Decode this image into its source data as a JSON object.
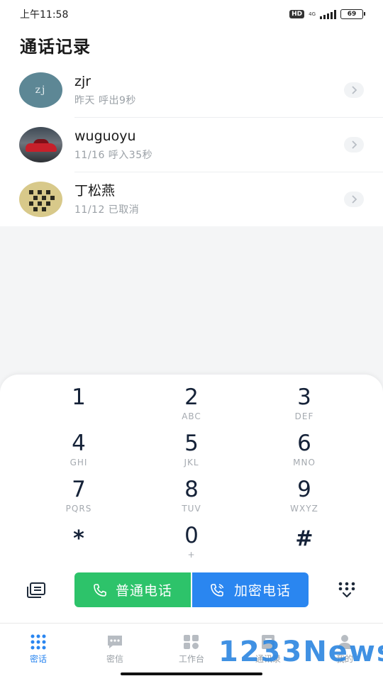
{
  "status_bar": {
    "time": "上午11:58",
    "hd": "HD",
    "network": "4G",
    "battery": "69"
  },
  "header": {
    "title": "通话记录"
  },
  "calls": [
    {
      "name": "zjr",
      "avatar_text": "zj",
      "meta": "昨天 呼出9秒"
    },
    {
      "name": "wuguoyu",
      "meta": "11/16 呼入35秒"
    },
    {
      "name": "丁松燕",
      "meta": "11/12 已取消"
    }
  ],
  "dialpad": {
    "keys": [
      {
        "digit": "1",
        "letters": ""
      },
      {
        "digit": "2",
        "letters": "ABC"
      },
      {
        "digit": "3",
        "letters": "DEF"
      },
      {
        "digit": "4",
        "letters": "GHI"
      },
      {
        "digit": "5",
        "letters": "JKL"
      },
      {
        "digit": "6",
        "letters": "MNO"
      },
      {
        "digit": "7",
        "letters": "PQRS"
      },
      {
        "digit": "8",
        "letters": "TUV"
      },
      {
        "digit": "9",
        "letters": "WXYZ"
      },
      {
        "digit": "*",
        "letters": ""
      },
      {
        "digit": "0",
        "letters": "+"
      },
      {
        "digit": "#",
        "letters": ""
      }
    ],
    "normal_call_label": "普通电话",
    "encrypted_call_label": "加密电话"
  },
  "tabs": [
    {
      "label": "密话",
      "icon": "dialpad-grid-icon",
      "active": true
    },
    {
      "label": "密信",
      "icon": "message-icon",
      "active": false
    },
    {
      "label": "工作台",
      "icon": "workbench-icon",
      "active": false
    },
    {
      "label": "通讯录",
      "icon": "contacts-icon",
      "active": false
    },
    {
      "label": "我的",
      "icon": "person-icon",
      "active": false
    }
  ],
  "watermark": "1233News",
  "colors": {
    "green_call": "#2dc36a",
    "blue_call": "#2a86f0",
    "active_tab": "#2a86f0"
  }
}
